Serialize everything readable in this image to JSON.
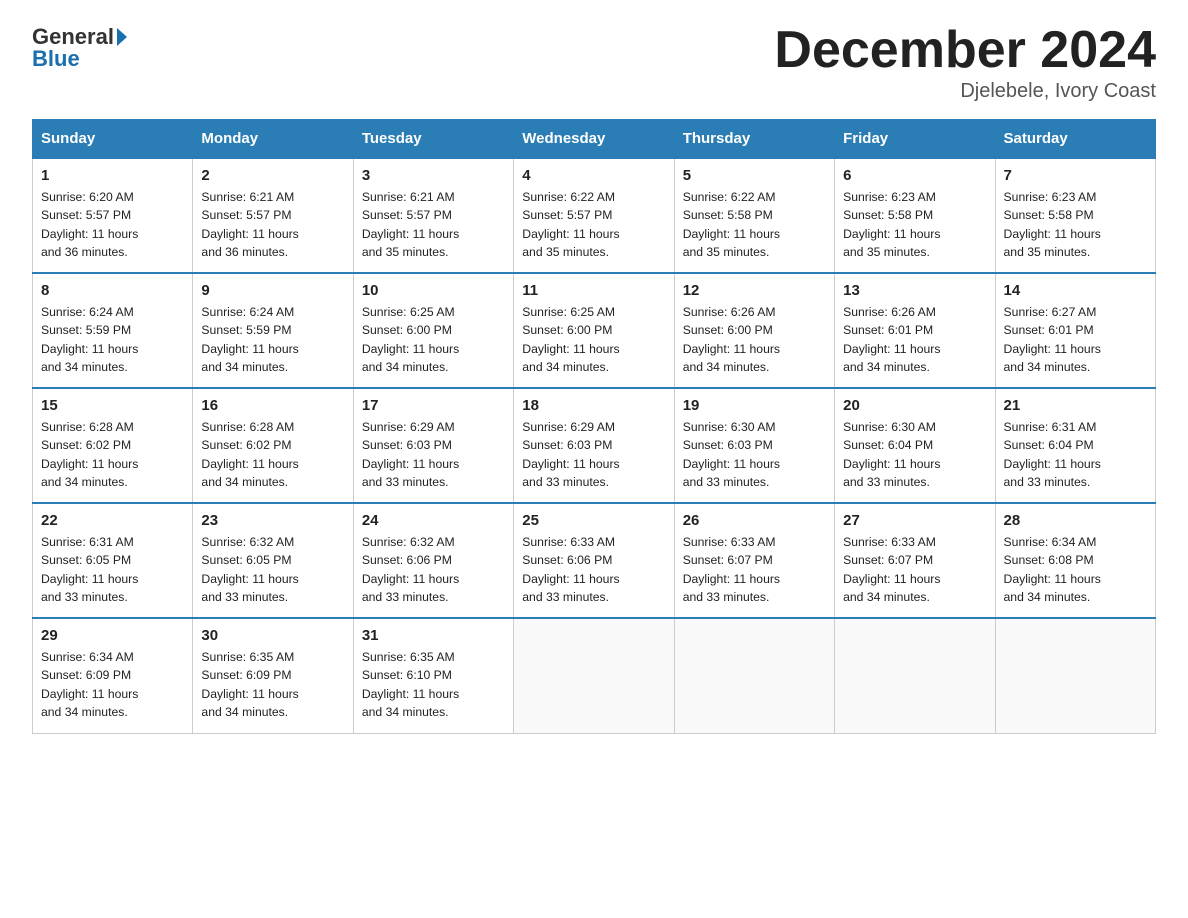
{
  "header": {
    "logo_general": "General",
    "logo_blue": "Blue",
    "month_title": "December 2024",
    "location": "Djelebele, Ivory Coast"
  },
  "days_of_week": [
    "Sunday",
    "Monday",
    "Tuesday",
    "Wednesday",
    "Thursday",
    "Friday",
    "Saturday"
  ],
  "weeks": [
    [
      {
        "day": "1",
        "info": "Sunrise: 6:20 AM\nSunset: 5:57 PM\nDaylight: 11 hours\nand 36 minutes."
      },
      {
        "day": "2",
        "info": "Sunrise: 6:21 AM\nSunset: 5:57 PM\nDaylight: 11 hours\nand 36 minutes."
      },
      {
        "day": "3",
        "info": "Sunrise: 6:21 AM\nSunset: 5:57 PM\nDaylight: 11 hours\nand 35 minutes."
      },
      {
        "day": "4",
        "info": "Sunrise: 6:22 AM\nSunset: 5:57 PM\nDaylight: 11 hours\nand 35 minutes."
      },
      {
        "day": "5",
        "info": "Sunrise: 6:22 AM\nSunset: 5:58 PM\nDaylight: 11 hours\nand 35 minutes."
      },
      {
        "day": "6",
        "info": "Sunrise: 6:23 AM\nSunset: 5:58 PM\nDaylight: 11 hours\nand 35 minutes."
      },
      {
        "day": "7",
        "info": "Sunrise: 6:23 AM\nSunset: 5:58 PM\nDaylight: 11 hours\nand 35 minutes."
      }
    ],
    [
      {
        "day": "8",
        "info": "Sunrise: 6:24 AM\nSunset: 5:59 PM\nDaylight: 11 hours\nand 34 minutes."
      },
      {
        "day": "9",
        "info": "Sunrise: 6:24 AM\nSunset: 5:59 PM\nDaylight: 11 hours\nand 34 minutes."
      },
      {
        "day": "10",
        "info": "Sunrise: 6:25 AM\nSunset: 6:00 PM\nDaylight: 11 hours\nand 34 minutes."
      },
      {
        "day": "11",
        "info": "Sunrise: 6:25 AM\nSunset: 6:00 PM\nDaylight: 11 hours\nand 34 minutes."
      },
      {
        "day": "12",
        "info": "Sunrise: 6:26 AM\nSunset: 6:00 PM\nDaylight: 11 hours\nand 34 minutes."
      },
      {
        "day": "13",
        "info": "Sunrise: 6:26 AM\nSunset: 6:01 PM\nDaylight: 11 hours\nand 34 minutes."
      },
      {
        "day": "14",
        "info": "Sunrise: 6:27 AM\nSunset: 6:01 PM\nDaylight: 11 hours\nand 34 minutes."
      }
    ],
    [
      {
        "day": "15",
        "info": "Sunrise: 6:28 AM\nSunset: 6:02 PM\nDaylight: 11 hours\nand 34 minutes."
      },
      {
        "day": "16",
        "info": "Sunrise: 6:28 AM\nSunset: 6:02 PM\nDaylight: 11 hours\nand 34 minutes."
      },
      {
        "day": "17",
        "info": "Sunrise: 6:29 AM\nSunset: 6:03 PM\nDaylight: 11 hours\nand 33 minutes."
      },
      {
        "day": "18",
        "info": "Sunrise: 6:29 AM\nSunset: 6:03 PM\nDaylight: 11 hours\nand 33 minutes."
      },
      {
        "day": "19",
        "info": "Sunrise: 6:30 AM\nSunset: 6:03 PM\nDaylight: 11 hours\nand 33 minutes."
      },
      {
        "day": "20",
        "info": "Sunrise: 6:30 AM\nSunset: 6:04 PM\nDaylight: 11 hours\nand 33 minutes."
      },
      {
        "day": "21",
        "info": "Sunrise: 6:31 AM\nSunset: 6:04 PM\nDaylight: 11 hours\nand 33 minutes."
      }
    ],
    [
      {
        "day": "22",
        "info": "Sunrise: 6:31 AM\nSunset: 6:05 PM\nDaylight: 11 hours\nand 33 minutes."
      },
      {
        "day": "23",
        "info": "Sunrise: 6:32 AM\nSunset: 6:05 PM\nDaylight: 11 hours\nand 33 minutes."
      },
      {
        "day": "24",
        "info": "Sunrise: 6:32 AM\nSunset: 6:06 PM\nDaylight: 11 hours\nand 33 minutes."
      },
      {
        "day": "25",
        "info": "Sunrise: 6:33 AM\nSunset: 6:06 PM\nDaylight: 11 hours\nand 33 minutes."
      },
      {
        "day": "26",
        "info": "Sunrise: 6:33 AM\nSunset: 6:07 PM\nDaylight: 11 hours\nand 33 minutes."
      },
      {
        "day": "27",
        "info": "Sunrise: 6:33 AM\nSunset: 6:07 PM\nDaylight: 11 hours\nand 34 minutes."
      },
      {
        "day": "28",
        "info": "Sunrise: 6:34 AM\nSunset: 6:08 PM\nDaylight: 11 hours\nand 34 minutes."
      }
    ],
    [
      {
        "day": "29",
        "info": "Sunrise: 6:34 AM\nSunset: 6:09 PM\nDaylight: 11 hours\nand 34 minutes."
      },
      {
        "day": "30",
        "info": "Sunrise: 6:35 AM\nSunset: 6:09 PM\nDaylight: 11 hours\nand 34 minutes."
      },
      {
        "day": "31",
        "info": "Sunrise: 6:35 AM\nSunset: 6:10 PM\nDaylight: 11 hours\nand 34 minutes."
      },
      {
        "day": "",
        "info": ""
      },
      {
        "day": "",
        "info": ""
      },
      {
        "day": "",
        "info": ""
      },
      {
        "day": "",
        "info": ""
      }
    ]
  ]
}
